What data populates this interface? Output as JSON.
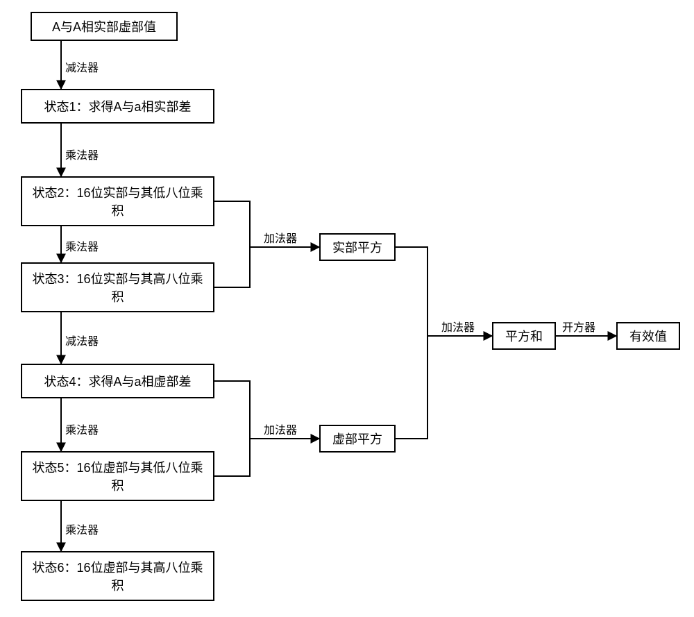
{
  "nodes": {
    "input": "A与A相实部虚部值",
    "state1": "状态1：求得A与a相实部差",
    "state2": "状态2：16位实部与其低八位乘积",
    "state3": "状态3：16位实部与其高八位乘积",
    "state4": "状态4：求得A与a相虚部差",
    "state5": "状态5：16位虚部与其低八位乘积",
    "state6": "状态6：16位虚部与其高八位乘积",
    "re_sq": "实部平方",
    "im_sq": "虚部平方",
    "sum_sq": "平方和",
    "rms": "有效值"
  },
  "edges": {
    "sub": "减法器",
    "mul": "乘法器",
    "add": "加法器",
    "sqrt": "开方器"
  }
}
